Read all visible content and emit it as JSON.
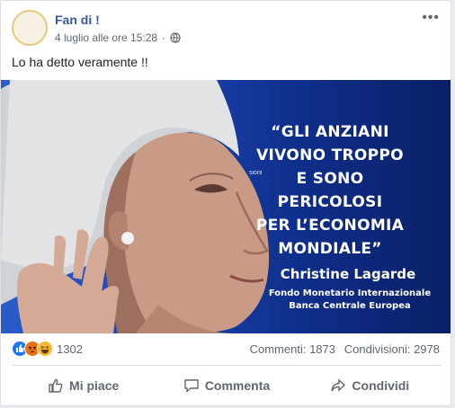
{
  "post": {
    "page_name": "Fan di !",
    "timestamp": "4 luglio alle ore 15:28",
    "separator": "·",
    "privacy_icon": "globe-icon",
    "more_icon": "•••",
    "text": "Lo ha detto veramente !!"
  },
  "image": {
    "quote_lines": [
      "“GLI ANZIANI",
      "VIVONO TROPPO",
      "E SONO",
      "PERICOLOSI",
      "PER L’ECONOMIA",
      "MONDIALE”"
    ],
    "author": "Christine Lagarde",
    "author_sub_lines": [
      "Fondo Monetario Internazionale",
      "Banca Centrale Europea"
    ],
    "watermark": "sioni",
    "colors": {
      "background_left": "#2a5cc9",
      "background_right": "#0a1f66",
      "hair": "#d9dadb",
      "skin": "#c79a86"
    }
  },
  "stats": {
    "reactions_count": "1302",
    "reaction_icons": [
      "like-icon",
      "angry-icon",
      "haha-icon"
    ],
    "comments": "Commenti: 1873",
    "shares": "Condivisioni: 2978"
  },
  "actions": {
    "like": "Mi piace",
    "comment": "Commenta",
    "share": "Condividi"
  },
  "colors": {
    "link": "#385898",
    "meta": "#606770",
    "like_blue": "#1877f2",
    "angry": "#e9710f",
    "haha": "#f7b928"
  }
}
